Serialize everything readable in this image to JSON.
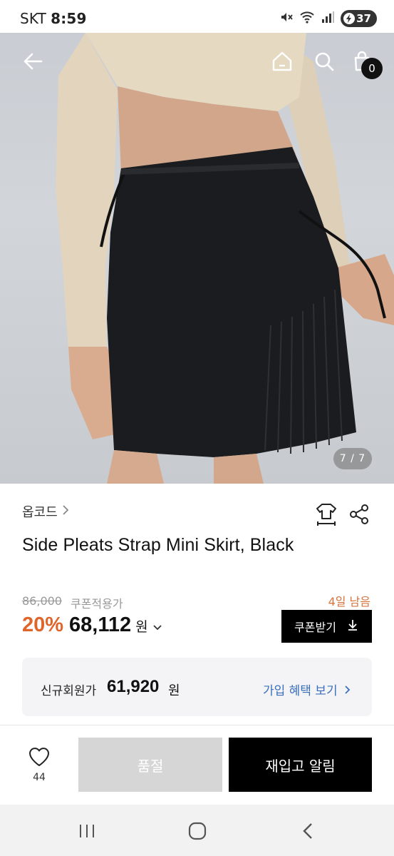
{
  "status_bar": {
    "carrier": "SKT",
    "time": "8:59",
    "battery": "37"
  },
  "top_nav": {
    "cart_count": "0",
    "image_page": "7 / 7"
  },
  "product": {
    "brand": "옵코드",
    "title": "Side Pleats Strap Mini Skirt, Black",
    "original_price": "86,000",
    "coupon_label": "쿠폰적용가",
    "days_left": "4일 남음",
    "discount": "20%",
    "sale_price": "68,112",
    "currency": "원",
    "coupon_button": "쿠폰받기"
  },
  "member_offer": {
    "label": "신규회원가",
    "price": "61,920",
    "currency": "원",
    "link": "가입 혜택 보기"
  },
  "action_bar": {
    "like_count": "44",
    "soldout_label": "품절",
    "restock_label": "재입고 알림"
  },
  "colors": {
    "discount": "#e0652a",
    "days_left": "#d7743e",
    "link": "#3a6fbf",
    "primary_button": "#000000",
    "disabled_button": "#d6d6d6"
  },
  "icons": [
    "back-arrow-icon",
    "home-icon",
    "search-icon",
    "cart-icon",
    "fit-guide-icon",
    "share-icon",
    "heart-icon",
    "download-icon",
    "recent-apps-icon",
    "home-circle-icon",
    "system-back-icon"
  ]
}
